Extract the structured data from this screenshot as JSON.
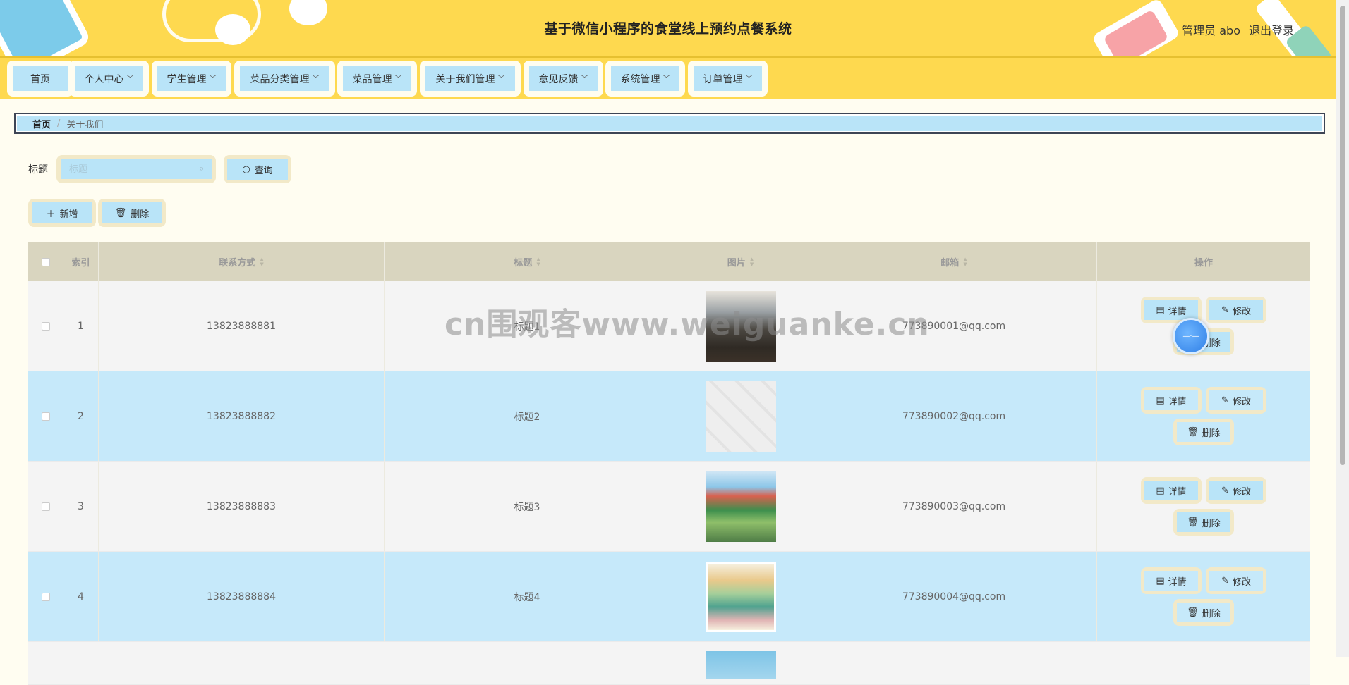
{
  "header": {
    "title": "基于微信小程序的食堂线上预约点餐系统",
    "user": "管理员 abo",
    "logout": "退出登录"
  },
  "nav": {
    "items": [
      {
        "label": "首页",
        "dropdown": false
      },
      {
        "label": "个人中心",
        "dropdown": true
      },
      {
        "label": "学生管理",
        "dropdown": true
      },
      {
        "label": "菜品分类管理",
        "dropdown": true
      },
      {
        "label": "菜品管理",
        "dropdown": true
      },
      {
        "label": "关于我们管理",
        "dropdown": true
      },
      {
        "label": "意见反馈",
        "dropdown": true
      },
      {
        "label": "系统管理",
        "dropdown": true
      },
      {
        "label": "订单管理",
        "dropdown": true
      }
    ]
  },
  "breadcrumb": {
    "home": "首页",
    "separator": "/",
    "current": "关于我们"
  },
  "search": {
    "label": "标题",
    "placeholder": "标题",
    "value": "",
    "query_button": "查询"
  },
  "actions": {
    "add": "新增",
    "delete": "删除"
  },
  "table": {
    "columns": {
      "index": "索引",
      "phone": "联系方式",
      "title": "标题",
      "image": "图片",
      "email": "邮箱",
      "ops": "操作"
    },
    "rows": [
      {
        "index": "1",
        "phone": "13823888881",
        "title": "标题1",
        "email": "773890001@qq.com"
      },
      {
        "index": "2",
        "phone": "13823888882",
        "title": "标题2",
        "email": "773890002@qq.com"
      },
      {
        "index": "3",
        "phone": "13823888883",
        "title": "标题3",
        "email": "773890003@qq.com"
      },
      {
        "index": "4",
        "phone": "13823888884",
        "title": "标题4",
        "email": "773890004@qq.com"
      }
    ],
    "row_actions": {
      "detail": "详情",
      "edit": "修改",
      "delete": "删除"
    }
  },
  "watermark": "cn围观客www.weiguanke.cn",
  "colors": {
    "header_bg": "#fed94f",
    "nav_button": "#b9e4f8",
    "table_head": "#d9d5bf",
    "row_highlight": "#c6e9fa"
  }
}
